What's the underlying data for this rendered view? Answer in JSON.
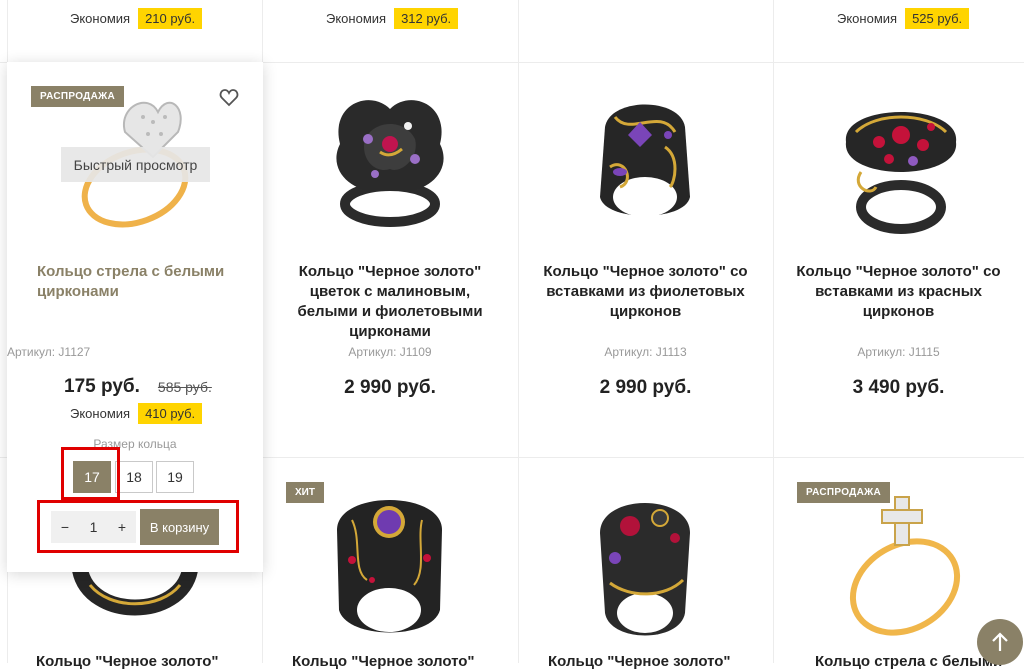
{
  "top_row": [
    {
      "saving_label": "Экономия",
      "saving_value": "210 руб."
    },
    {
      "saving_label": "Экономия",
      "saving_value": "312 руб."
    },
    {
      "saving_label": "",
      "saving_value": ""
    },
    {
      "saving_label": "Экономия",
      "saving_value": "525 руб."
    }
  ],
  "hover_card": {
    "badge": "РАСПРОДАЖА",
    "quick_view": "Быстрый просмотр",
    "title": "Кольцо стрела с белыми цирконами",
    "sku": "Артикул: J1127",
    "price": "175 руб.",
    "old_price": "585 руб.",
    "saving_label": "Экономия",
    "saving_value": "410 руб.",
    "size_label": "Размер кольца",
    "sizes": [
      "17",
      "18",
      "19"
    ],
    "quantity": "1",
    "minus": "−",
    "plus": "+",
    "add_to_cart": "В корзину"
  },
  "products": [
    {
      "title": "Кольцо \"Черное золото\" цветок с малиновым, белыми и фиолетовыми цирконами",
      "sku": "Артикул: J1109",
      "price": "2 990 руб."
    },
    {
      "title": "Кольцо \"Черное золото\" со вставками из фиолетовых цирконов",
      "sku": "Артикул: J1113",
      "price": "2 990 руб."
    },
    {
      "title": "Кольцо \"Черное золото\" со вставками из красных цирконов",
      "sku": "Артикул: J1115",
      "price": "3 490 руб."
    }
  ],
  "second_row": [
    {
      "badge": ""
    },
    {
      "badge": "ХИТ"
    },
    {
      "badge": ""
    },
    {
      "badge": "РАСПРОДАЖА"
    }
  ],
  "bottom_titles": [
    "Кольцо \"Черное золото\"",
    "Кольцо \"Черное золото\"",
    "Кольцо \"Черное золото\"",
    "Кольцо стрела с белыми"
  ],
  "colors": {
    "accent": "#8a8167",
    "saving_badge": "#ffd400",
    "highlight": "#e00000"
  },
  "icons": {
    "favorite": "heart-icon",
    "scroll_top": "arrow-up-icon",
    "minus": "minus-icon",
    "plus": "plus-icon"
  }
}
